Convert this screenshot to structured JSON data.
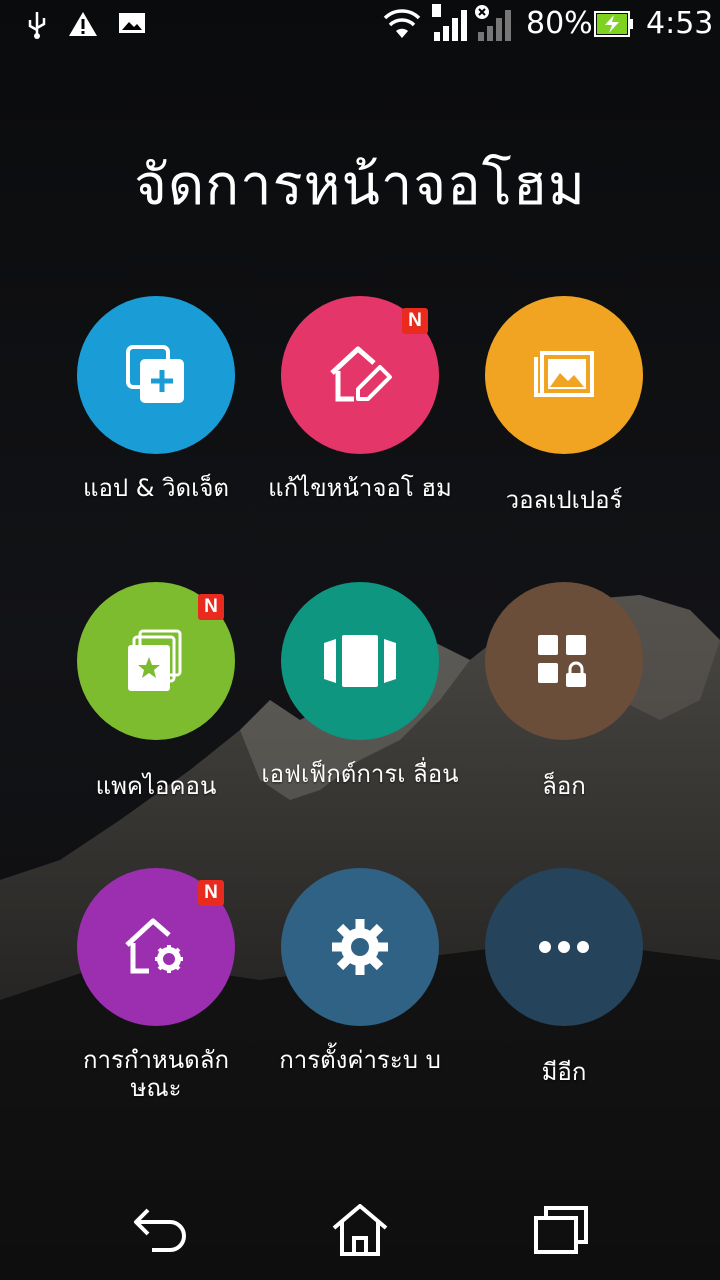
{
  "status_bar": {
    "battery_percent": "80%",
    "time": "4:53",
    "icons": [
      "usb-icon",
      "warning-icon",
      "image-icon",
      "wifi-icon",
      "signal-sim1-icon",
      "signal-sim2-no-service-icon",
      "battery-charging-icon"
    ]
  },
  "title": "จัดการหน้าจอโฮม",
  "tiles": [
    {
      "label": "แอป & วิดเจ็ต",
      "color": "#1a9dd6",
      "icon": "apps-widgets-icon",
      "badge": ""
    },
    {
      "label": "แก้ไขหน้าจอโ ฮม",
      "color": "#e5366a",
      "icon": "edit-home-icon",
      "badge": "N"
    },
    {
      "label": "วอลเปเปอร์",
      "color": "#f0a421",
      "icon": "wallpaper-icon",
      "badge": ""
    },
    {
      "label": "แพคไอคอน",
      "color": "#7dbb2f",
      "icon": "icon-pack-icon",
      "badge": "N"
    },
    {
      "label": "เอฟเฟ็กต์การเ ลื่อน",
      "color": "#0e9680",
      "icon": "scroll-effect-icon",
      "badge": ""
    },
    {
      "label": "ล็อก",
      "color": "#6a4e3a",
      "icon": "lock-apps-icon",
      "badge": ""
    },
    {
      "label": "การกำหนดลัก ษณะ",
      "color": "#9b2fb0",
      "icon": "home-settings-icon",
      "badge": "N"
    },
    {
      "label": "การตั้งค่าระบ บ",
      "color": "#2f6285",
      "icon": "gear-icon",
      "badge": ""
    },
    {
      "label": "มีอีก",
      "color": "#25435a",
      "icon": "more-icon",
      "badge": ""
    }
  ],
  "nav": [
    "back-icon",
    "home-icon",
    "recents-icon"
  ]
}
